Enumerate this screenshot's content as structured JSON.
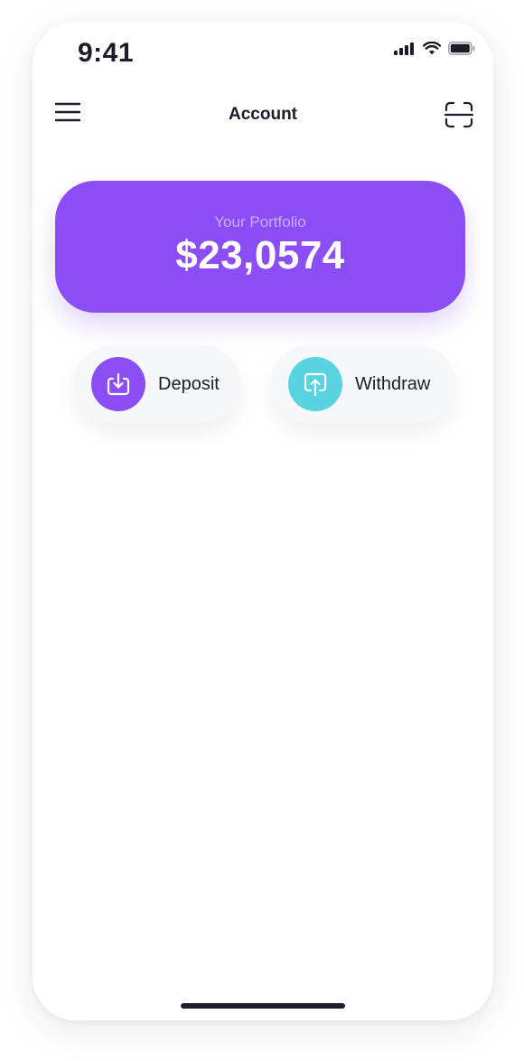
{
  "status_bar": {
    "time": "9:41",
    "icons": [
      "cellular-signal-icon",
      "wifi-icon",
      "battery-icon"
    ]
  },
  "header": {
    "title": "Account",
    "menu_icon": "hamburger-menu-icon",
    "scan_icon": "scan-icon"
  },
  "portfolio": {
    "label": "Your Portfolio",
    "value": "$23,0574",
    "color": "#8b4df5"
  },
  "actions": {
    "deposit": {
      "label": "Deposit",
      "icon": "download-tray-icon",
      "color": "#8b4df5"
    },
    "withdraw": {
      "label": "Withdraw",
      "icon": "upload-tray-icon",
      "color": "#5ad3e0"
    }
  },
  "colors": {
    "text_dark": "#1b1d2a",
    "pill_background": "#f6f7f8"
  }
}
